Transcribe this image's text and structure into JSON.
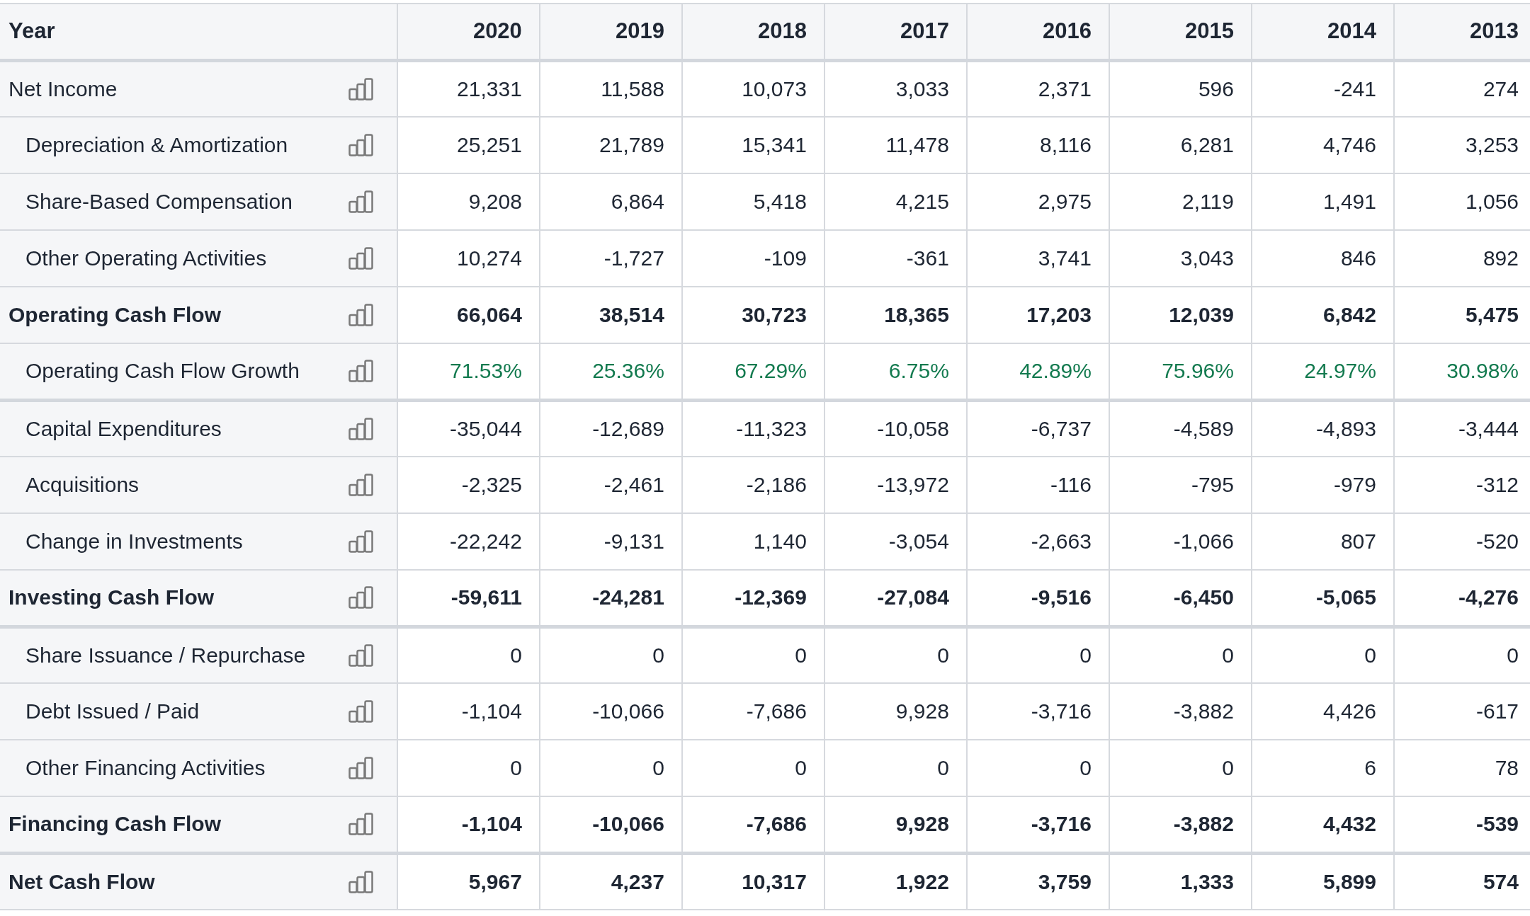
{
  "table": {
    "columns": [
      "Year",
      "2020",
      "2019",
      "2018",
      "2017",
      "2016",
      "2015",
      "2014",
      "2013"
    ],
    "sections": [
      {
        "rows": [
          {
            "label": "Net Income",
            "kind": "line",
            "values": [
              "21,331",
              "11,588",
              "10,073",
              "3,033",
              "2,371",
              "596",
              "-241",
              "274"
            ]
          },
          {
            "label": "Depreciation & Amortization",
            "kind": "sub",
            "values": [
              "25,251",
              "21,789",
              "15,341",
              "11,478",
              "8,116",
              "6,281",
              "4,746",
              "3,253"
            ]
          },
          {
            "label": "Share-Based Compensation",
            "kind": "sub",
            "values": [
              "9,208",
              "6,864",
              "5,418",
              "4,215",
              "2,975",
              "2,119",
              "1,491",
              "1,056"
            ]
          },
          {
            "label": "Other Operating Activities",
            "kind": "sub",
            "values": [
              "10,274",
              "-1,727",
              "-109",
              "-361",
              "3,741",
              "3,043",
              "846",
              "892"
            ]
          },
          {
            "label": "Operating Cash Flow",
            "kind": "total",
            "values": [
              "66,064",
              "38,514",
              "30,723",
              "18,365",
              "17,203",
              "12,039",
              "6,842",
              "5,475"
            ]
          },
          {
            "label": "Operating Cash Flow Growth",
            "kind": "growth",
            "values": [
              "71.53%",
              "25.36%",
              "67.29%",
              "6.75%",
              "42.89%",
              "75.96%",
              "24.97%",
              "30.98%"
            ]
          }
        ]
      },
      {
        "rows": [
          {
            "label": "Capital Expenditures",
            "kind": "sub",
            "values": [
              "-35,044",
              "-12,689",
              "-11,323",
              "-10,058",
              "-6,737",
              "-4,589",
              "-4,893",
              "-3,444"
            ]
          },
          {
            "label": "Acquisitions",
            "kind": "sub",
            "values": [
              "-2,325",
              "-2,461",
              "-2,186",
              "-13,972",
              "-116",
              "-795",
              "-979",
              "-312"
            ]
          },
          {
            "label": "Change in Investments",
            "kind": "sub",
            "values": [
              "-22,242",
              "-9,131",
              "1,140",
              "-3,054",
              "-2,663",
              "-1,066",
              "807",
              "-520"
            ]
          },
          {
            "label": "Investing Cash Flow",
            "kind": "total",
            "values": [
              "-59,611",
              "-24,281",
              "-12,369",
              "-27,084",
              "-9,516",
              "-6,450",
              "-5,065",
              "-4,276"
            ]
          }
        ]
      },
      {
        "rows": [
          {
            "label": "Share Issuance / Repurchase",
            "kind": "sub",
            "values": [
              "0",
              "0",
              "0",
              "0",
              "0",
              "0",
              "0",
              "0"
            ]
          },
          {
            "label": "Debt Issued / Paid",
            "kind": "sub",
            "values": [
              "-1,104",
              "-10,066",
              "-7,686",
              "9,928",
              "-3,716",
              "-3,882",
              "4,426",
              "-617"
            ]
          },
          {
            "label": "Other Financing Activities",
            "kind": "sub",
            "values": [
              "0",
              "0",
              "0",
              "0",
              "0",
              "0",
              "6",
              "78"
            ]
          },
          {
            "label": "Financing Cash Flow",
            "kind": "total",
            "values": [
              "-1,104",
              "-10,066",
              "-7,686",
              "9,928",
              "-3,716",
              "-3,882",
              "4,432",
              "-539"
            ]
          }
        ]
      },
      {
        "rows": [
          {
            "label": "Net Cash Flow",
            "kind": "total",
            "values": [
              "5,967",
              "4,237",
              "10,317",
              "1,922",
              "3,759",
              "1,333",
              "5,899",
              "574"
            ]
          }
        ]
      }
    ]
  }
}
